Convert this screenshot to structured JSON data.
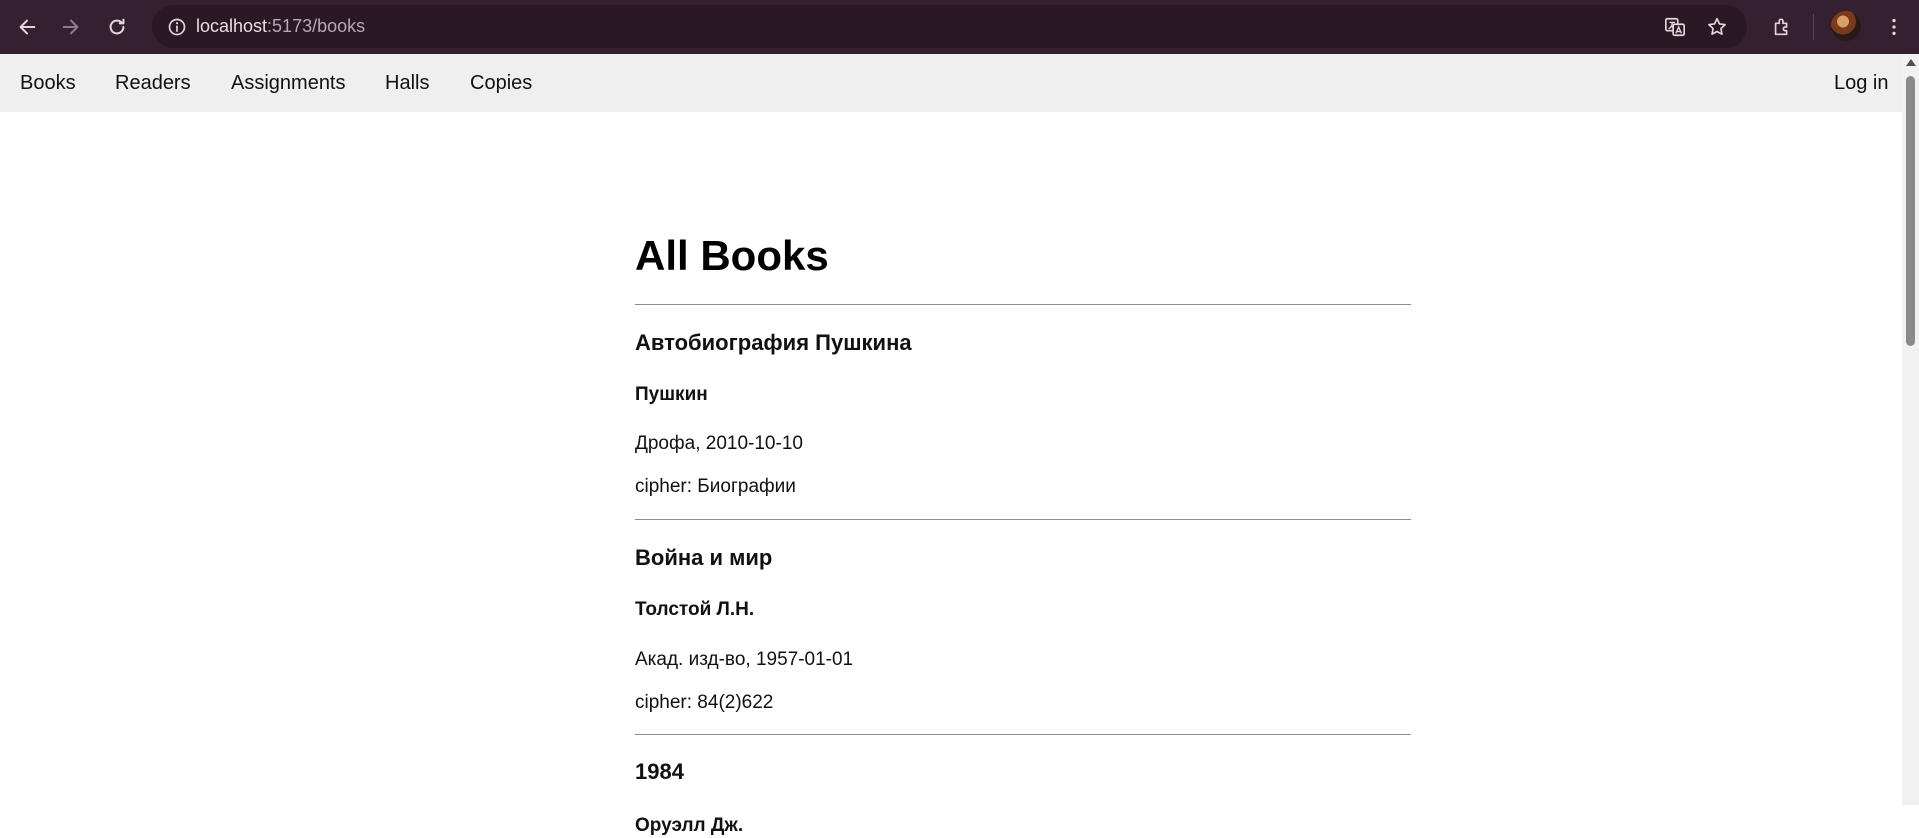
{
  "browser": {
    "url_host": "localhost",
    "url_path": ":5173/books",
    "icons": [
      "back-arrow-icon",
      "forward-arrow-icon",
      "reload-icon",
      "site-info-icon",
      "translate-icon",
      "bookmark-star-icon",
      "extensions-icon",
      "profile-avatar",
      "more-menu-icon"
    ]
  },
  "nav": {
    "books": "Books",
    "readers": "Readers",
    "assignments": "Assignments",
    "halls": "Halls",
    "copies": "Copies",
    "login": "Log in"
  },
  "main": {
    "title": "All Books",
    "books": [
      {
        "title": "Автобиография Пушкина",
        "author": "Пушкин",
        "publisher_date": "Дрофа, 2010-10-10",
        "cipher": "cipher: Биографии"
      },
      {
        "title": "Война и мир",
        "author": "Толстой Л.Н.",
        "publisher_date": "Акад. изд-во, 1957-01-01",
        "cipher": "cipher: 84(2)622"
      },
      {
        "title": "1984",
        "author": "Оруэлл Дж."
      }
    ]
  },
  "colors": {
    "chrome_bg": "#35202f",
    "navbar_bg": "#efefef",
    "divider": "#8e8e8e"
  }
}
